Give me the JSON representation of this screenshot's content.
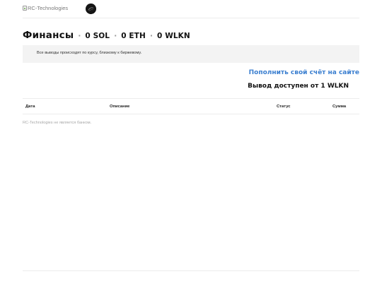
{
  "header": {
    "logo_alt": "RC-Technologies"
  },
  "balances": {
    "title": "Финансы",
    "separator": "·",
    "items": [
      {
        "label": "0 SOL"
      },
      {
        "label": "0 ETH"
      },
      {
        "label": "0 WLKN"
      }
    ]
  },
  "notice": {
    "text": "Все выводы происходят по курсу, близкому к биржевому."
  },
  "actions": {
    "topup_label": "Пополнить свой счёт на сайте",
    "withdraw_note": "Вывод доступен от 1 WLKN"
  },
  "table": {
    "columns": {
      "date": "Дата",
      "description": "Описание",
      "status": "Статус",
      "amount": "Сумма"
    }
  },
  "disclaimer": "RC-Technologies не является банком.",
  "colors": {
    "link": "#3b7fd0",
    "notice_bg": "#f3f3f3",
    "muted": "#a8a8a8"
  }
}
